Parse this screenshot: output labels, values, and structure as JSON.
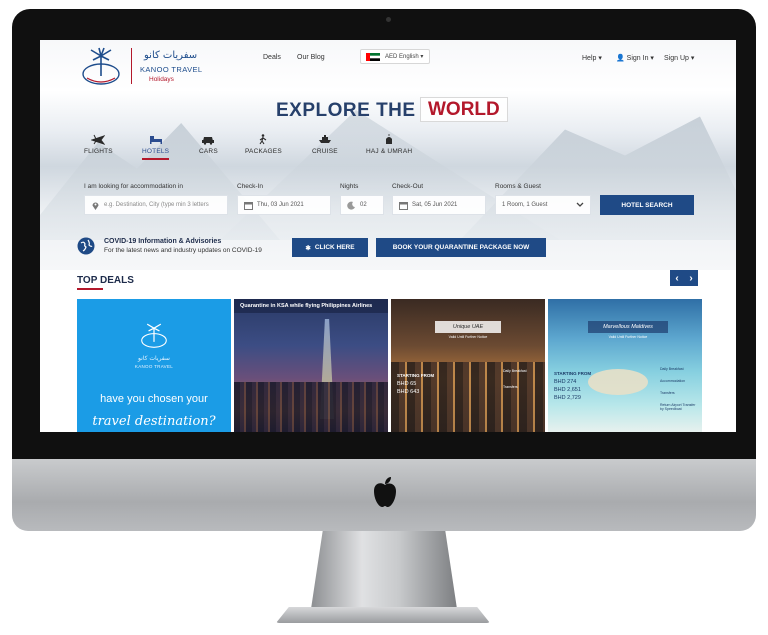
{
  "site": {
    "logo_arabic": "سفريات كانو",
    "logo_name": "KANOO TRAVEL",
    "logo_sub": "Holidays"
  },
  "nav": {
    "links": [
      "Deals",
      "Our Blog"
    ],
    "language": "AED English ▾",
    "help": "Help ▾",
    "sign_in": "Sign In ▾",
    "sign_up": "Sign Up ▾"
  },
  "hero": {
    "title_left": "EXPLORE THE",
    "title_right": "WORLD"
  },
  "tabs": [
    {
      "label": "FLIGHTS",
      "icon": "plane-icon"
    },
    {
      "label": "HOTELS",
      "icon": "bed-icon",
      "active": true
    },
    {
      "label": "CARS",
      "icon": "car-icon"
    },
    {
      "label": "PACKAGES",
      "icon": "hiker-icon"
    },
    {
      "label": "CRUISE",
      "icon": "ship-icon"
    },
    {
      "label": "HAJ & UMRAH",
      "icon": "mosque-icon"
    }
  ],
  "search": {
    "destination_label": "I am looking for accommodation in",
    "destination_placeholder": "e.g. Destination, City (type min 3 letters",
    "checkin_label": "Check-In",
    "checkin_value": "Thu, 03 Jun 2021",
    "nights_label": "Nights",
    "nights_value": "02",
    "checkout_label": "Check-Out",
    "checkout_value": "Sat, 05 Jun 2021",
    "rooms_label": "Rooms & Guest",
    "rooms_value": "1 Room, 1 Guest",
    "button": "HOTEL SEARCH"
  },
  "covid": {
    "title": "COVID-19 Information & Advisories",
    "subtitle": "For the latest news and industry updates on COVID-19",
    "click_button": "CLICK HERE",
    "book_button": "BOOK YOUR QUARANTINE PACKAGE NOW"
  },
  "deals": {
    "title": "TOP DEALS",
    "cards": [
      {
        "arabic": "سفريات كانو",
        "name": "KANOO TRAVEL",
        "text": "have you chosen your",
        "script": "travel destination?"
      },
      {
        "banner": "Quarantine in KSA while flying Philippines Airlines"
      },
      {
        "badge": "Unique UAE",
        "sub": "Valid Until Further Notice",
        "starting": "STARTING FROM",
        "price_old": "BHD 65",
        "price_new": "BHD 643",
        "features": [
          "Daily Breakfast",
          "Transfers"
        ]
      },
      {
        "badge": "Marvellous Maldives",
        "sub": "Valid Until Further Notice",
        "starting": "STARTING FROM",
        "price_old": "BHD 274",
        "price_mid": "BHD 2,651",
        "price_new": "BHD 2,729",
        "features": [
          "Daily Breakfast",
          "Accommodation",
          "Transfers",
          "Return Airport Transfer by Speedboat"
        ]
      }
    ]
  }
}
